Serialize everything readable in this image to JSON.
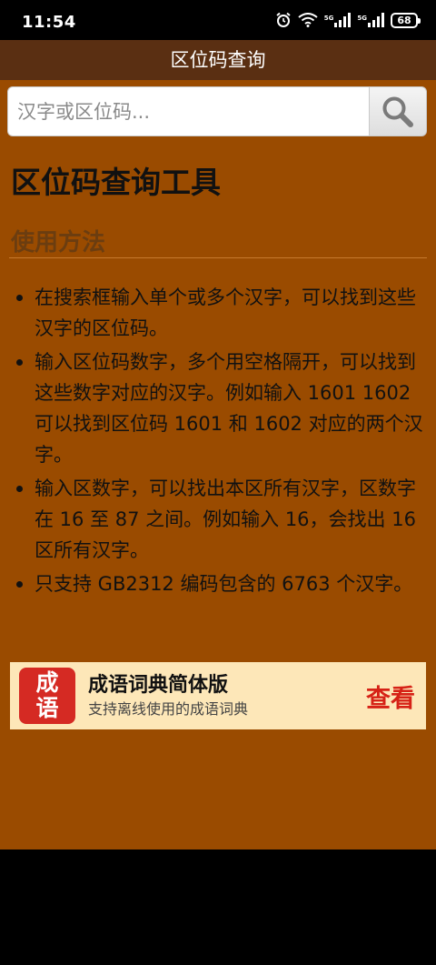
{
  "status_bar": {
    "time": "11:54",
    "network_1": "5G",
    "network_2": "5G",
    "battery": "68",
    "icons": [
      "alarm-icon",
      "wifi-icon",
      "signal-icon",
      "signal-icon",
      "battery-icon"
    ]
  },
  "app_bar": {
    "title": "区位码查询"
  },
  "search": {
    "placeholder": "汉字或区位码...",
    "value": "",
    "button_icon": "search-icon"
  },
  "main": {
    "title": "区位码查询工具",
    "section_heading": "使用方法",
    "usage_items": [
      "在搜索框输入单个或多个汉字，可以找到这些汉字的区位码。",
      "输入区位码数字，多个用空格隔开，可以找到这些数字对应的汉字。例如输入 1601 1602 可以找到区位码 1601 和 1602 对应的两个汉字。",
      "输入区数字，可以找出本区所有汉字，区数字在 16 至 87 之间。例如输入 16，会找出 16 区所有汉字。",
      "只支持 GB2312 编码包含的 6763 个汉字。"
    ]
  },
  "ad": {
    "logo_line1": "成",
    "logo_line2": "语",
    "title": "成语词典简体版",
    "subtitle": "支持离线使用的成语词典",
    "action": "查看"
  },
  "colors": {
    "content_bg": "#9a4b00",
    "app_bar_bg": "#5a2f12",
    "ad_bg": "#fde7b8",
    "ad_action": "#d62216",
    "ad_logo_bg": "#d52a23"
  }
}
